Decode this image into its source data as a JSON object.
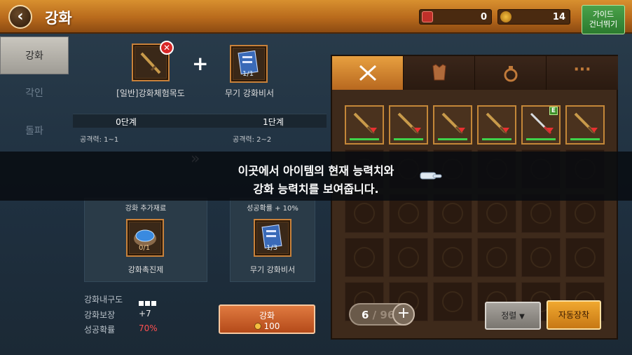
{
  "header": {
    "title": "강화",
    "currency_1": "0",
    "currency_2": "14",
    "guide_line1": "가이드",
    "guide_line2": "건너뛰기"
  },
  "side_tabs": [
    {
      "label": "강화",
      "active": true
    },
    {
      "label": "각인",
      "active": false
    },
    {
      "label": "돌파",
      "active": false
    }
  ],
  "upgrade": {
    "target_item": "[일반]강화체험목도",
    "material_item": "무기 강화비서",
    "material_count": "1/1",
    "plus_sign": "+",
    "stage_current": "0단계",
    "stage_next": "1단계",
    "attack_current": "공격력: 1~1",
    "attack_next": "공격력: 2~2",
    "arrow": "»",
    "extra_mat_title": "강화 추가재료",
    "extra_mat_name": "강화촉진제",
    "extra_mat_count": "0/1",
    "success_title": "성공확률 + 10%",
    "success_item_name": "무기 강화비서",
    "success_item_count": "1/3",
    "durability_label": "강화내구도",
    "protect_label": "강화보장",
    "protect_value": "+7",
    "rate_label": "성공확률",
    "rate_value": "70%",
    "enhance_label": "강화",
    "enhance_cost": "100"
  },
  "tutorial": {
    "line1": "이곳에서 아이템의 현재 능력치와",
    "line2": "강화 능력치를 보여줍니다."
  },
  "inventory": {
    "tabs": [
      "sword-icon",
      "armor-icon",
      "ring-icon",
      "more-icon"
    ],
    "more_label": "···",
    "count_current": "6",
    "count_sep": "/",
    "count_max": "96",
    "plus_label": "+",
    "sort_label": "정렬",
    "auto_label": "자동장착",
    "equipped_badge": "E"
  },
  "colors": {
    "accent_orange": "#d8902f",
    "success_red": "#ff5050",
    "durability_white": "#ffffff"
  }
}
